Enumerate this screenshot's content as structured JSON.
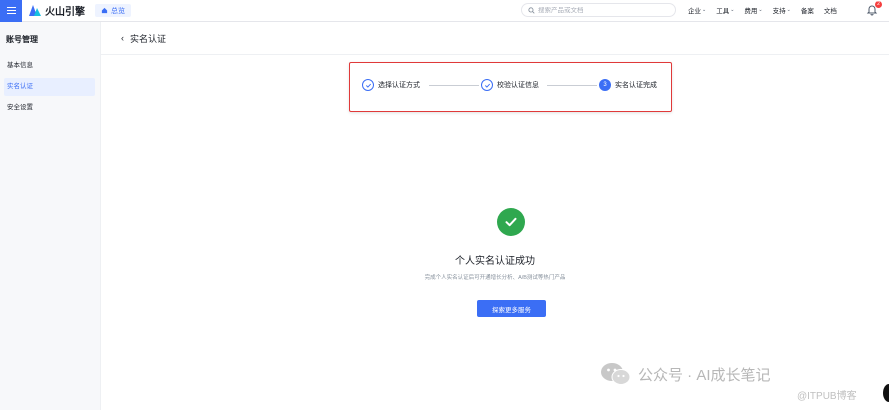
{
  "topbar": {
    "brand": "火山引擎",
    "home_tab": "总览",
    "search_placeholder": "搜索产品或文档",
    "nav": [
      {
        "label": "企业",
        "has_menu": true
      },
      {
        "label": "工具",
        "has_menu": true
      },
      {
        "label": "费用",
        "has_menu": true
      },
      {
        "label": "支持",
        "has_menu": true
      },
      {
        "label": "备案",
        "has_menu": false
      },
      {
        "label": "文档",
        "has_menu": false
      }
    ],
    "notification_count": "2"
  },
  "sidebar": {
    "title": "账号管理",
    "items": [
      {
        "label": "基本信息",
        "active": false
      },
      {
        "label": "实名认证",
        "active": true
      },
      {
        "label": "安全设置",
        "active": false
      }
    ]
  },
  "page": {
    "back_glyph": "‹",
    "title": "实名认证"
  },
  "steps": [
    {
      "label": "选择认证方式",
      "status": "done"
    },
    {
      "label": "校验认证信息",
      "status": "done"
    },
    {
      "label": "实名认证完成",
      "status": "current",
      "number": "3"
    }
  ],
  "result": {
    "title": "个人实名认证成功",
    "description": "完成个人实名认证后可开通增长分析、A/B测试等热门产品",
    "button": "探索更多服务"
  },
  "watermark": {
    "text": "公众号 · AI成长笔记",
    "credit": "@ITPUB博客"
  },
  "colors": {
    "accent": "#3b6ef5",
    "success": "#2fa84f",
    "highlight_border": "#e03a3a"
  }
}
